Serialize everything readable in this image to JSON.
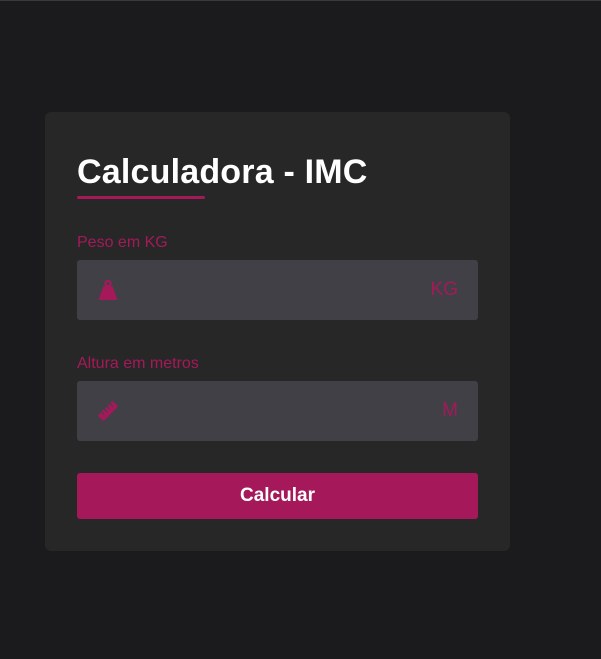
{
  "title": "Calculadora - IMC",
  "colors": {
    "accent": "#a5195a",
    "background": "#1b1b1d",
    "card": "#272727",
    "input": "#404046",
    "text": "#ffffff"
  },
  "weight": {
    "label": "Peso em KG",
    "icon": "weight-icon",
    "value": "",
    "unit": "KG"
  },
  "height": {
    "label": "Altura em metros",
    "icon": "ruler-icon",
    "value": "",
    "unit": "M"
  },
  "button": {
    "label": "Calcular"
  }
}
